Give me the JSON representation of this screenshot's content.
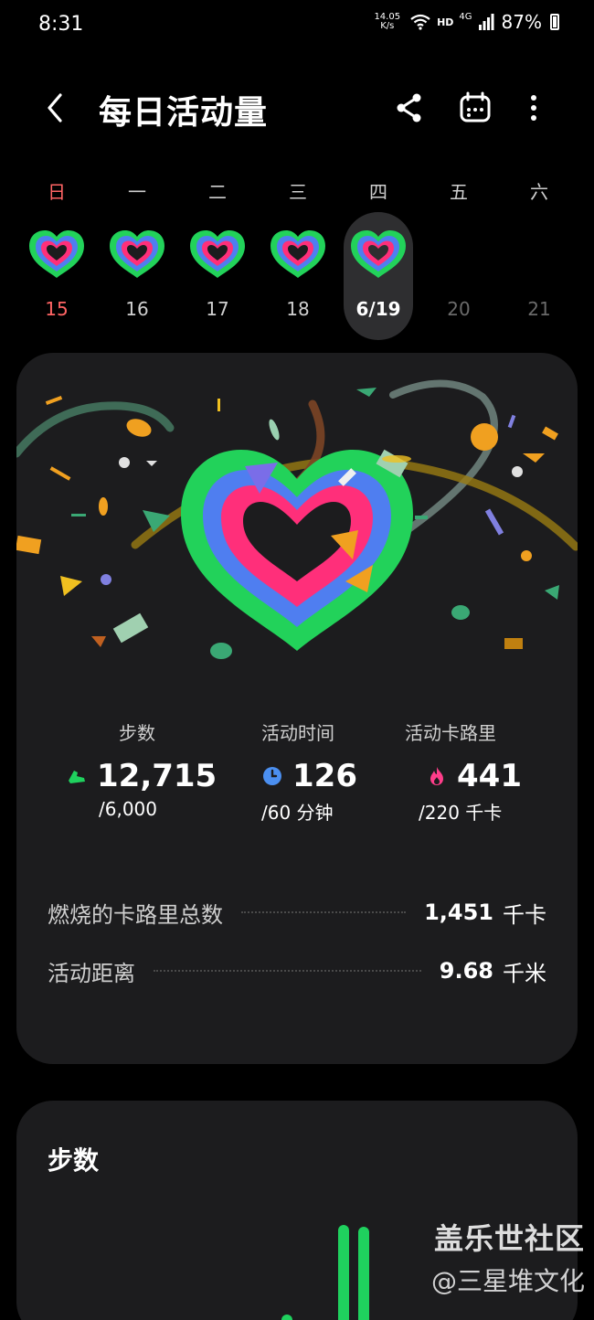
{
  "status_bar": {
    "time": "8:31",
    "net_speed_value": "14.05",
    "net_speed_unit": "K/s",
    "hd": "HD",
    "network": "4G",
    "battery": "87%"
  },
  "header": {
    "title": "每日活动量",
    "icons": [
      "back-icon",
      "share-icon",
      "calendar-icon",
      "more-icon"
    ]
  },
  "week": {
    "days": [
      {
        "weekday": "日",
        "date": "15",
        "has_heart": true,
        "sunday": true
      },
      {
        "weekday": "一",
        "date": "16",
        "has_heart": true
      },
      {
        "weekday": "二",
        "date": "17",
        "has_heart": true
      },
      {
        "weekday": "三",
        "date": "18",
        "has_heart": true
      },
      {
        "weekday": "四",
        "date": "6/19",
        "has_heart": true,
        "selected": true
      },
      {
        "weekday": "五",
        "date": "20",
        "has_heart": false
      },
      {
        "weekday": "六",
        "date": "21",
        "has_heart": false
      }
    ]
  },
  "metrics": {
    "steps": {
      "label": "步数",
      "value": "12,715",
      "goal": "/6,000",
      "color": "#1fd15e",
      "icon": "shoe-icon"
    },
    "active_time": {
      "label": "活动时间",
      "value": "126",
      "goal": "/60 分钟",
      "color": "#4b8ff0",
      "icon": "clock-icon"
    },
    "active_calories": {
      "label": "活动卡路里",
      "value": "441",
      "goal": "/220 千卡",
      "color": "#ff3d8a",
      "icon": "flame-icon"
    }
  },
  "summary": {
    "total_calories": {
      "label": "燃烧的卡路里总数",
      "value": "1,451",
      "unit": "千卡"
    },
    "distance": {
      "label": "活动距离",
      "value": "9.68",
      "unit": "千米"
    }
  },
  "steps_card": {
    "title": "步数"
  },
  "watermark": {
    "line1": "盖乐世社区",
    "line2": "@三星堆文化"
  },
  "colors": {
    "ring_outer": "#22d25a",
    "ring_middle": "#4f7ef0",
    "ring_inner": "#ff2f7a",
    "card_bg": "#1c1c1e"
  }
}
